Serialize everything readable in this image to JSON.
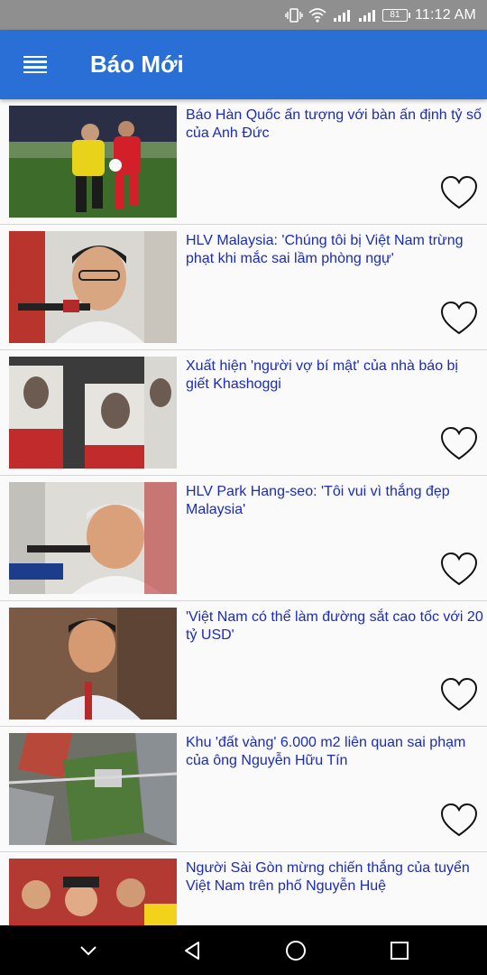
{
  "status_bar": {
    "time": "11:12 AM",
    "battery": "81",
    "icons": [
      "vibrate-icon",
      "wifi-icon",
      "signal-icon",
      "signal-icon",
      "battery-icon"
    ]
  },
  "app_bar": {
    "title": "Báo Mới",
    "menu_icon": "menu-icon",
    "color": "#2a6fd6"
  },
  "feed": {
    "headline_color": "#1a2bbd",
    "items": [
      {
        "title": "Báo Hàn Quốc ấn tượng với bàn ấn định tỷ số của Anh Đức",
        "thumb": "football-match-photo",
        "favorite_icon": "heart-outline-icon"
      },
      {
        "title": "HLV Malaysia: 'Chúng tôi bị Việt Nam trừng phạt khi mắc sai lầm phòng ngự'",
        "thumb": "coach-press-conference-photo",
        "favorite_icon": "heart-outline-icon"
      },
      {
        "title": "Xuất hiện 'người vợ bí mật' của nhà báo bị giết Khashoggi",
        "thumb": "protest-signs-photo",
        "favorite_icon": "heart-outline-icon"
      },
      {
        "title": "HLV Park Hang-seo: 'Tôi vui vì thắng đẹp Malaysia'",
        "thumb": "coach-microphone-photo",
        "favorite_icon": "heart-outline-icon"
      },
      {
        "title": "'Việt Nam có thể làm đường sắt cao tốc với 20 tỷ USD'",
        "thumb": "official-speaking-photo",
        "favorite_icon": "heart-outline-icon"
      },
      {
        "title": "Khu 'đất vàng' 6.000 m2 liên quan sai phạm của ông Nguyễn Hữu Tín",
        "thumb": "aerial-city-photo",
        "favorite_icon": "heart-outline-icon"
      },
      {
        "title": "Người Sài Gòn mừng chiến thắng của tuyển Việt Nam trên phố Nguyễn Huệ",
        "thumb": "celebrating-crowd-photo",
        "favorite_icon": "heart-outline-icon"
      }
    ]
  },
  "nav_bar": {
    "buttons": [
      "chevron-down-icon",
      "back-icon",
      "home-icon",
      "recents-icon"
    ]
  }
}
